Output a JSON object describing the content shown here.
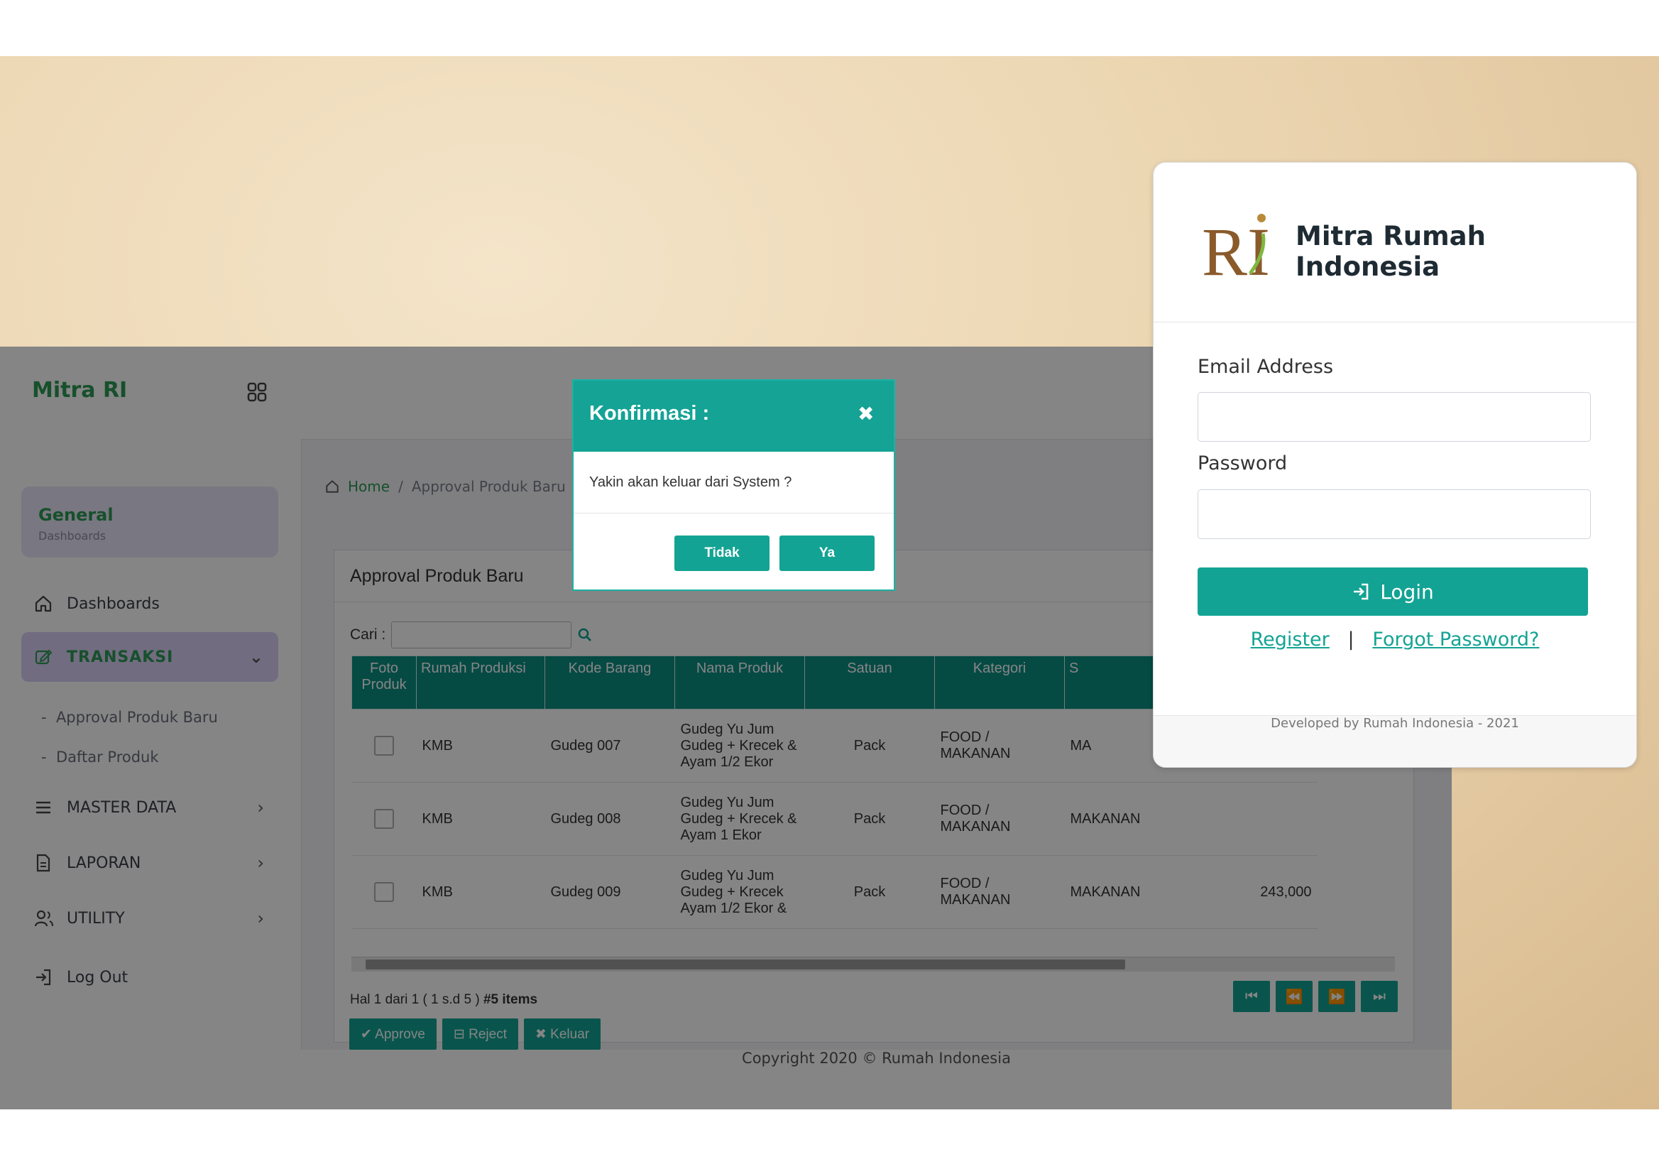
{
  "app": {
    "brand": "Mitra RI",
    "general": {
      "title": "General",
      "subtitle": "Dashboards"
    },
    "nav": {
      "dashboards": "Dashboards",
      "transaksi": "TRANSAKSI",
      "approval": "Approval Produk Baru",
      "daftar": "Daftar Produk",
      "master": "MASTER DATA",
      "laporan": "LAPORAN",
      "utility": "UTILITY",
      "logout": "Log Out"
    },
    "breadcrumb": {
      "home": "Home",
      "sep": "/",
      "current": "Approval Produk Baru"
    },
    "panel": {
      "title": "Approval Produk Baru",
      "search_label": "Cari :"
    },
    "table": {
      "headers": [
        "Foto Produk",
        "Rumah Produksi",
        "Kode Barang",
        "Nama Produk",
        "Satuan",
        "Kategori",
        "S"
      ],
      "rows": [
        {
          "rumah": "KMB",
          "kode": "Gudeg 007",
          "nama": "Gudeg Yu Jum Gudeg + Krecek & Ayam 1/2 Ekor",
          "satuan": "Pack",
          "kategori": "FOOD / MAKANAN",
          "sub": "MA",
          "harga": ""
        },
        {
          "rumah": "KMB",
          "kode": "Gudeg 008",
          "nama": "Gudeg Yu Jum Gudeg + Krecek & Ayam 1 Ekor",
          "satuan": "Pack",
          "kategori": "FOOD / MAKANAN",
          "sub": "MAKANAN",
          "harga": ""
        },
        {
          "rumah": "KMB",
          "kode": "Gudeg 009",
          "nama": "Gudeg Yu Jum Gudeg + Krecek Ayam 1/2 Ekor &",
          "satuan": "Pack",
          "kategori": "FOOD / MAKANAN",
          "sub": "MAKANAN",
          "harga": "243,000"
        }
      ]
    },
    "pagination": {
      "info": "Hal 1 dari 1 ( 1 s.d 5 )",
      "items": "#5 items"
    },
    "actions": {
      "approve": "✔ Approve",
      "reject": "⊟ Reject",
      "keluar": "✖ Keluar"
    },
    "copyright": "Copyright 2020 © Rumah Indonesia"
  },
  "modal": {
    "title": "Konfirmasi :",
    "message": "Yakin akan keluar dari System ?",
    "no": "Tidak",
    "yes": "Ya"
  },
  "login": {
    "logo_text": "RI",
    "title": "Mitra Rumah Indonesia",
    "email_label": "Email Address",
    "password_label": "Password",
    "login_button": "Login",
    "register": "Register",
    "divider": "|",
    "forgot": "Forgot Password?",
    "footer": "Developed by Rumah Indonesia - 2021"
  },
  "colors": {
    "accent": "#13a394",
    "brand_green": "#2c9a55",
    "active_nav": "#d8d0f5"
  }
}
